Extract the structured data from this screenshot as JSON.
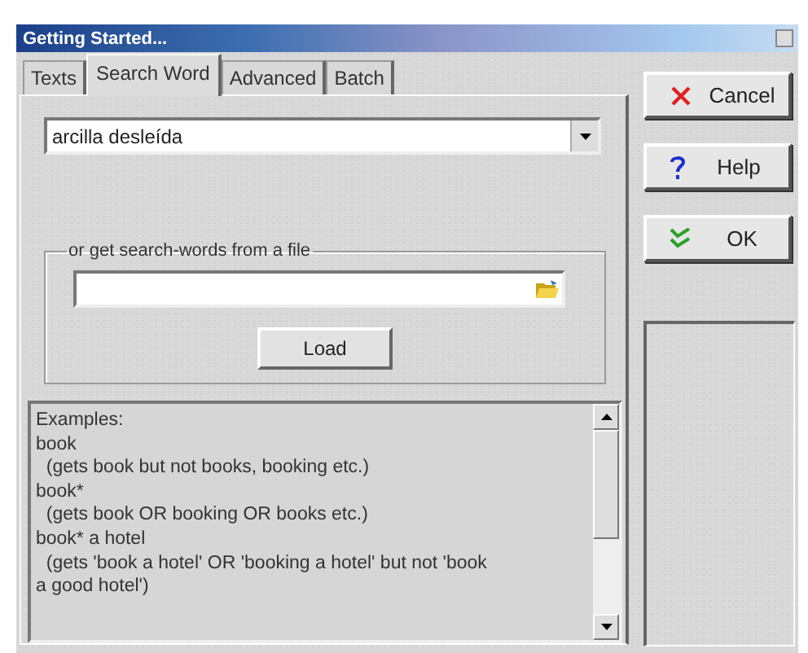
{
  "window": {
    "title": "Getting Started..."
  },
  "tabs": [
    {
      "label": "Texts",
      "selected": false
    },
    {
      "label": "Search Word",
      "selected": true
    },
    {
      "label": "Advanced",
      "selected": false
    },
    {
      "label": "Batch",
      "selected": false
    }
  ],
  "search_word": {
    "value": "arcilla desleída"
  },
  "file_group": {
    "legend": "or get search-words from a file",
    "load_button": "Load"
  },
  "examples": [
    "Examples:",
    "book",
    "  (gets book but not books, booking etc.)",
    "book*",
    "  (gets book OR booking OR books etc.)",
    "book* a hotel",
    "  (gets 'book a hotel' OR 'booking a hotel' but not 'book",
    "a good hotel')"
  ],
  "buttons": [
    {
      "kind": "cancel",
      "label": "Cancel"
    },
    {
      "kind": "help",
      "label": "Help"
    },
    {
      "kind": "ok",
      "label": "OK"
    }
  ]
}
